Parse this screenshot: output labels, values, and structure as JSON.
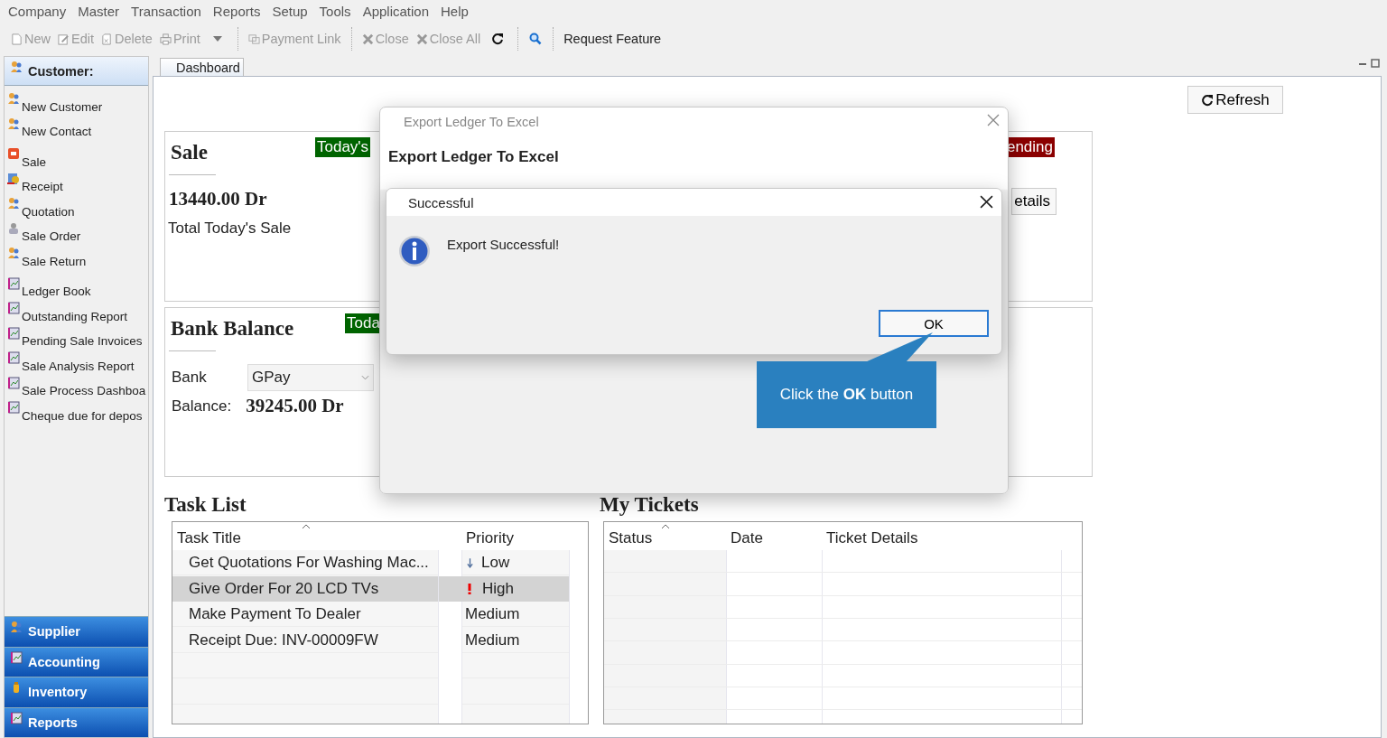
{
  "menu": [
    "Company",
    "Master",
    "Transaction",
    "Reports",
    "Setup",
    "Tools",
    "Application",
    "Help"
  ],
  "toolbar": [
    {
      "kind": "new",
      "label": "New",
      "disabled": true
    },
    {
      "kind": "edit",
      "label": "Edit",
      "disabled": true
    },
    {
      "kind": "delete",
      "label": "Delete",
      "disabled": true
    },
    {
      "kind": "print",
      "label": "Print",
      "disabled": true
    },
    {
      "kind": "dropdown",
      "disabled": true
    },
    {
      "kind": "separator"
    },
    {
      "kind": "link",
      "label": "Payment Link",
      "disabled": true
    },
    {
      "kind": "separator"
    },
    {
      "kind": "close",
      "label": "Close",
      "disabled": true
    },
    {
      "kind": "close",
      "label": "Close All",
      "disabled": true
    },
    {
      "kind": "refresh",
      "disabled": false
    },
    {
      "kind": "separator"
    },
    {
      "kind": "search",
      "disabled": false
    },
    {
      "kind": "separator"
    },
    {
      "kind": "text",
      "label": "Request Feature",
      "disabled": false
    }
  ],
  "sidebar": {
    "header": "Customer:",
    "groups": [
      [
        {
          "label": "New Customer",
          "kind": "person"
        },
        {
          "label": "New Contact",
          "kind": "person"
        }
      ],
      [
        {
          "label": "Sale",
          "kind": "sale"
        },
        {
          "label": "Receipt",
          "kind": "receipt"
        },
        {
          "label": "Quotation",
          "kind": "person"
        },
        {
          "label": "Sale Order",
          "kind": "order"
        },
        {
          "label": "Sale Return",
          "kind": "person"
        }
      ],
      [
        {
          "label": "Ledger Book",
          "kind": "report"
        },
        {
          "label": "Outstanding Report",
          "kind": "report"
        },
        {
          "label": "Pending Sale Invoices",
          "kind": "report"
        },
        {
          "label": "Sale Analysis Report",
          "kind": "report"
        },
        {
          "label": "Sale Process Dashboa",
          "kind": "report"
        },
        {
          "label": "Cheque due for depos",
          "kind": "report"
        }
      ]
    ],
    "sections": [
      {
        "label": "Supplier",
        "kind": "person"
      },
      {
        "label": "Accounting",
        "kind": "report"
      },
      {
        "label": "Inventory",
        "kind": "bottle"
      },
      {
        "label": "Reports",
        "kind": "report"
      }
    ]
  },
  "tabs": [
    {
      "label": "Dashboard",
      "selected": true
    }
  ],
  "refresh_button": "Refresh",
  "sale_card": {
    "title": "Sale",
    "badge": "Today's",
    "amount": "13440.00 Dr",
    "caption": "Total Today's Sale"
  },
  "bank_card": {
    "title": "Bank Balance",
    "badge": "Toda",
    "bank_label": "Bank",
    "bank_value": "GPay",
    "balance_label": "Balance:",
    "balance": "39245.00 Dr"
  },
  "pending_card": {
    "badge": "ending",
    "button": "etails"
  },
  "task_list": {
    "title": "Task List",
    "columns": [
      "Task Title",
      "Priority"
    ],
    "rows": [
      {
        "title": "Get Quotations For Washing Mac...",
        "priority": "Low",
        "kind": "low",
        "selected": false
      },
      {
        "title": "Give Order For 20 LCD TVs",
        "priority": "High",
        "kind": "high",
        "selected": true
      },
      {
        "title": "Make Payment To Dealer",
        "priority": "Medium",
        "kind": "medium",
        "selected": false
      },
      {
        "title": "Receipt Due: INV-00009FW",
        "priority": "Medium",
        "kind": "medium",
        "selected": false
      }
    ]
  },
  "tickets": {
    "title": "My Tickets",
    "columns": [
      "Status",
      "Date",
      "Ticket Details"
    ]
  },
  "export_dialog": {
    "title": "Export Ledger To Excel",
    "heading": "Export Ledger To Excel"
  },
  "message_dialog": {
    "title": "Successful",
    "text": "Export Successful!",
    "button": "OK"
  },
  "callout": {
    "text": "Click the **OK** button"
  }
}
